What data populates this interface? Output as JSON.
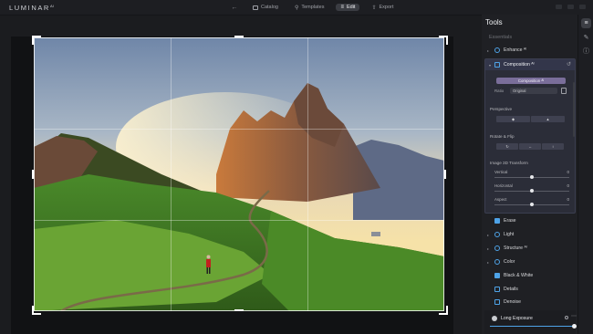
{
  "app": {
    "logo": "LUMINAR",
    "logo_sup": "AI"
  },
  "nav": {
    "back_icon": "arrow-left",
    "tabs": [
      {
        "label": "Catalog",
        "icon": "folder-icon"
      },
      {
        "label": "Templates",
        "icon": "search-icon"
      },
      {
        "label": "Edit",
        "icon": "sliders-icon"
      },
      {
        "label": "Export",
        "icon": "share-icon"
      }
    ]
  },
  "tools": {
    "title": "Tools",
    "essentials": "Essentials",
    "enhance": "Enhance ᴬᴵ",
    "composition_header": "Composition ᴬᴵ",
    "composition_button": "Composition ᴬᴵ",
    "ratio_label": "Ratio",
    "ratio_value": "Original",
    "perspective_label": "Perspective",
    "rotate_flip_label": "Rotate & Flip",
    "transform_label": "Image 3D Transform",
    "sliders": [
      {
        "label": "Vertical",
        "value": "0"
      },
      {
        "label": "Horizontal",
        "value": "0"
      },
      {
        "label": "Aspect",
        "value": "0"
      }
    ],
    "items": [
      {
        "label": "Erase",
        "icon": "erase-icon"
      },
      {
        "label": "Light",
        "icon": "sun-icon"
      },
      {
        "label": "Structure ᴬᴵ",
        "icon": "structure-icon"
      },
      {
        "label": "Color",
        "icon": "color-icon"
      },
      {
        "label": "Black & White",
        "icon": "bw-icon"
      },
      {
        "label": "Details",
        "icon": "details-icon"
      },
      {
        "label": "Denoise",
        "icon": "denoise-icon"
      }
    ],
    "long_exposure": "Long Exposure"
  },
  "colors": {
    "accent": "#4ea3e8",
    "composition_button": "#7a6e9a"
  }
}
